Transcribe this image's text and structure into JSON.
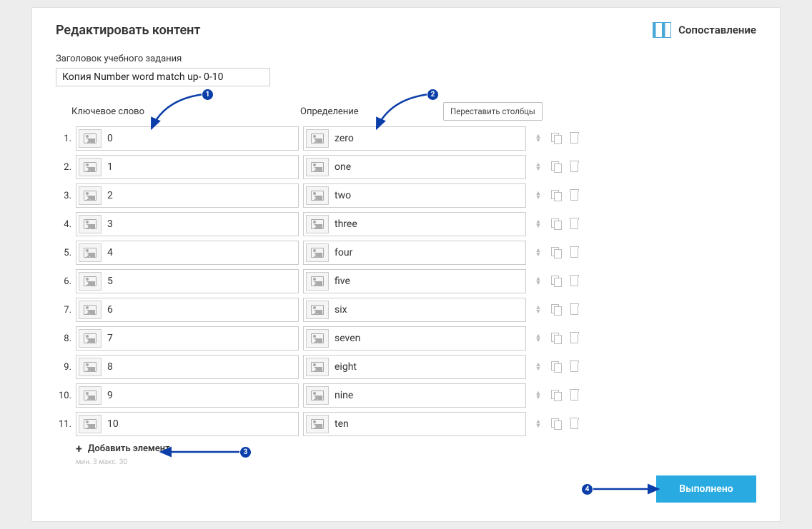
{
  "header": {
    "title": "Редактировать контент",
    "type_label": "Сопоставление"
  },
  "title_section": {
    "label": "Заголовок учебного задания",
    "value": "Копия Number word match up- 0-10"
  },
  "columns": {
    "keyword": "Ключевое слово",
    "definition": "Определение",
    "swap_btn": "Переставить столбцы"
  },
  "rows": [
    {
      "n": "1.",
      "k": "0",
      "d": "zero"
    },
    {
      "n": "2.",
      "k": "1",
      "d": "one"
    },
    {
      "n": "3.",
      "k": "2",
      "d": "two"
    },
    {
      "n": "4.",
      "k": "3",
      "d": "three"
    },
    {
      "n": "5.",
      "k": "4",
      "d": "four"
    },
    {
      "n": "6.",
      "k": "5",
      "d": "five"
    },
    {
      "n": "7.",
      "k": "6",
      "d": "six"
    },
    {
      "n": "8.",
      "k": "7",
      "d": "seven"
    },
    {
      "n": "9.",
      "k": "8",
      "d": "eight"
    },
    {
      "n": "10.",
      "k": "9",
      "d": "nine"
    },
    {
      "n": "11.",
      "k": "10",
      "d": "ten"
    }
  ],
  "add_item": "Добавить элемент",
  "limits": "мин. 3  макс. 30",
  "done": "Выполнено",
  "annotations": {
    "a1": "1",
    "a2": "2",
    "a3": "3",
    "a4": "4"
  }
}
